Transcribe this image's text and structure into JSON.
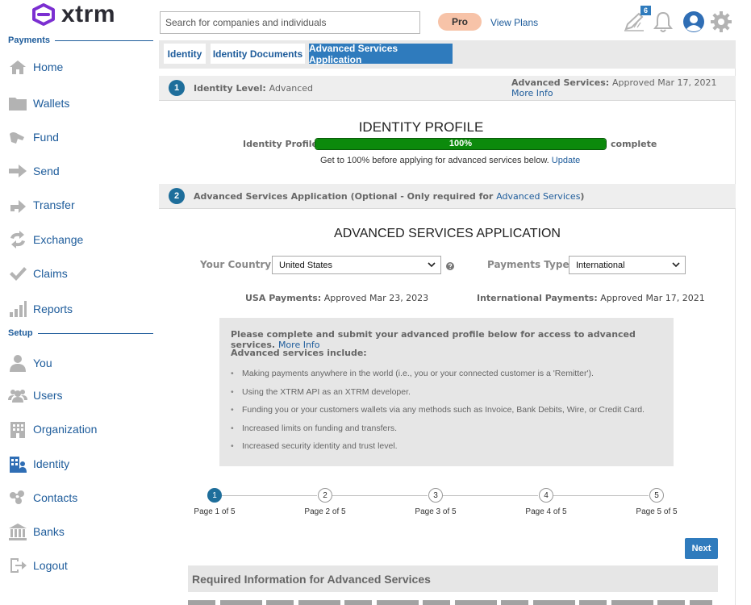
{
  "brand": {
    "name": "xtrm",
    "accent": "#7b2fd1"
  },
  "sidebar": {
    "sections": {
      "payments": "Payments",
      "setup": "Setup"
    },
    "items": [
      {
        "label": "Home",
        "icon": "home-icon"
      },
      {
        "label": "Wallets",
        "icon": "folder-icon"
      },
      {
        "label": "Fund",
        "icon": "fund-icon"
      },
      {
        "label": "Send",
        "icon": "send-arrow-icon"
      },
      {
        "label": "Transfer",
        "icon": "transfer-icon"
      },
      {
        "label": "Exchange",
        "icon": "exchange-icon"
      },
      {
        "label": "Claims",
        "icon": "check-icon"
      },
      {
        "label": "Reports",
        "icon": "bar-chart-icon"
      },
      {
        "label": "You",
        "icon": "user-icon"
      },
      {
        "label": "Users",
        "icon": "users-icon"
      },
      {
        "label": "Organization",
        "icon": "building-icon"
      },
      {
        "label": "Identity",
        "icon": "identity-icon"
      },
      {
        "label": "Contacts",
        "icon": "contacts-icon"
      },
      {
        "label": "Banks",
        "icon": "bank-icon"
      },
      {
        "label": "Logout",
        "icon": "logout-icon"
      }
    ]
  },
  "topbar": {
    "search_placeholder": "Search for companies and individuals",
    "plan_badge": "Pro",
    "view_plans": "View Plans",
    "notification_count": "6"
  },
  "tabs": [
    {
      "label": "Identity",
      "active": false
    },
    {
      "label": "Identity Documents",
      "active": false
    },
    {
      "label": "Advanced Services Application",
      "active": true
    }
  ],
  "section1": {
    "number": "1",
    "label": "Identity Level:",
    "value": "Advanced",
    "right_label": "Advanced Services:",
    "right_value": "Approved  Mar 17, 2021",
    "more_info": "More Info"
  },
  "profile": {
    "title": "IDENTITY PROFILE",
    "label": "Identity Profile",
    "progress_pct": 100,
    "progress_text": "100%",
    "complete_label": "complete",
    "note": "Get to 100% before applying for advanced services below.",
    "update_link": "Update"
  },
  "section2": {
    "number": "2",
    "label": "Advanced Services Application (Optional - Only required for",
    "link": "Advanced Services",
    "close": ")"
  },
  "application": {
    "title": "ADVANCED SERVICES APPLICATION",
    "country_label": "Your Country:",
    "country_value": "United States",
    "payments_type_label": "Payments Type:",
    "payments_type_value": "International",
    "usa_label": "USA Payments:",
    "usa_value": "Approved   Mar 23, 2023",
    "intl_label": "International Payments:",
    "intl_value": "Approved   Mar 17, 2021"
  },
  "info_box": {
    "heading": "Please complete and submit your advanced profile below for access to advanced services.",
    "more_info": "More Info",
    "subheading": "Advanced services include:",
    "items": [
      "Making payments anywhere in the world (i.e., you or your connected customer is a 'Remitter').",
      "Using the XTRM API as an XTRM developer.",
      "Funding you or your customers wallets via any methods such as Invoice, Bank Debits, Wire, or Credit Card.",
      "Increased limits on funding and transfers.",
      "Increased security identity and trust level."
    ]
  },
  "wizard": {
    "steps": [
      {
        "num": "1",
        "label": "Page 1 of 5",
        "active": true
      },
      {
        "num": "2",
        "label": "Page 2 of 5",
        "active": false
      },
      {
        "num": "3",
        "label": "Page 3 of 5",
        "active": false
      },
      {
        "num": "4",
        "label": "Page 4 of 5",
        "active": false
      },
      {
        "num": "5",
        "label": "Page 5 of 5",
        "active": false
      }
    ],
    "next": "Next"
  },
  "required_info": {
    "title": "Required Information for Advanced Services"
  }
}
